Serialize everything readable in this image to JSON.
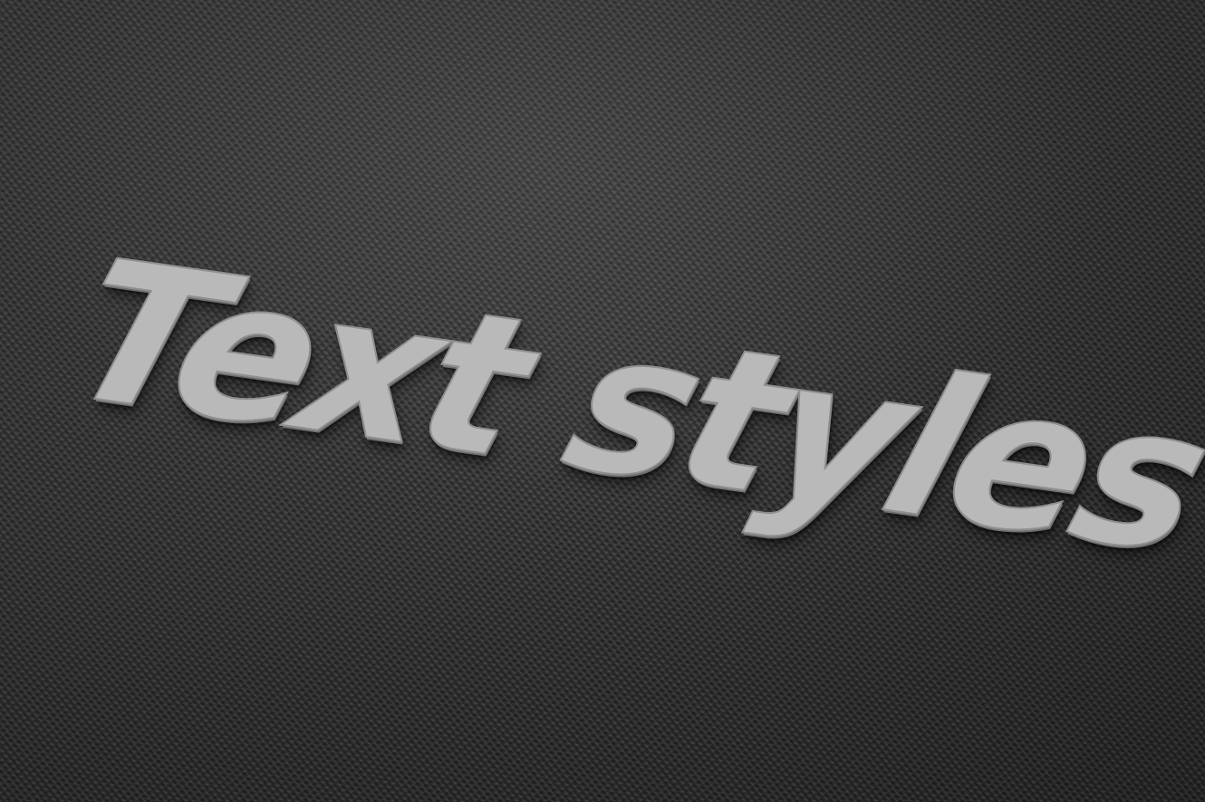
{
  "headline": {
    "text": "Text styles"
  },
  "colors": {
    "fabric": "#3b3b3b",
    "text_face": "#b9b9b9",
    "text_edge": "#8e8e8e"
  }
}
